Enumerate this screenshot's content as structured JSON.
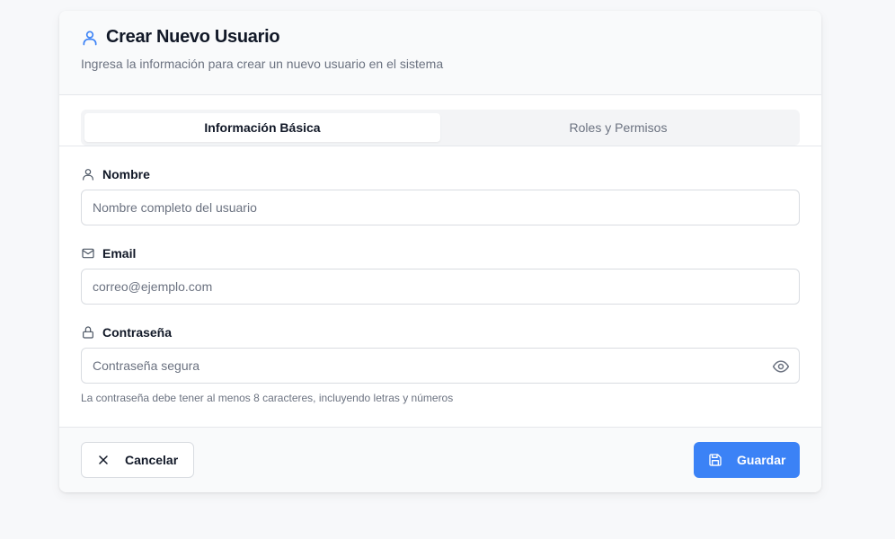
{
  "header": {
    "title": "Crear Nuevo Usuario",
    "subtitle": "Ingresa la información para crear un nuevo usuario en el sistema",
    "icon": "user-icon"
  },
  "tabs": [
    {
      "label": "Información Básica",
      "active": true
    },
    {
      "label": "Roles y Permisos",
      "active": false
    }
  ],
  "form": {
    "name": {
      "label": "Nombre",
      "icon": "user-icon",
      "placeholder": "Nombre completo del usuario",
      "value": ""
    },
    "email": {
      "label": "Email",
      "icon": "mail-icon",
      "placeholder": "correo@ejemplo.com",
      "value": ""
    },
    "password": {
      "label": "Contraseña",
      "icon": "lock-icon",
      "placeholder": "Contraseña segura",
      "value": "",
      "toggle_icon": "eye-icon",
      "hint": "La contraseña debe tener al menos 8 caracteres, incluyendo letras y números"
    }
  },
  "footer": {
    "cancel_label": "Cancelar",
    "cancel_icon": "close-icon",
    "save_label": "Guardar",
    "save_icon": "save-icon"
  },
  "colors": {
    "accent": "#3b82f6",
    "background": "#f7f8fa",
    "text_primary": "#111827",
    "text_muted": "#6b7280"
  }
}
